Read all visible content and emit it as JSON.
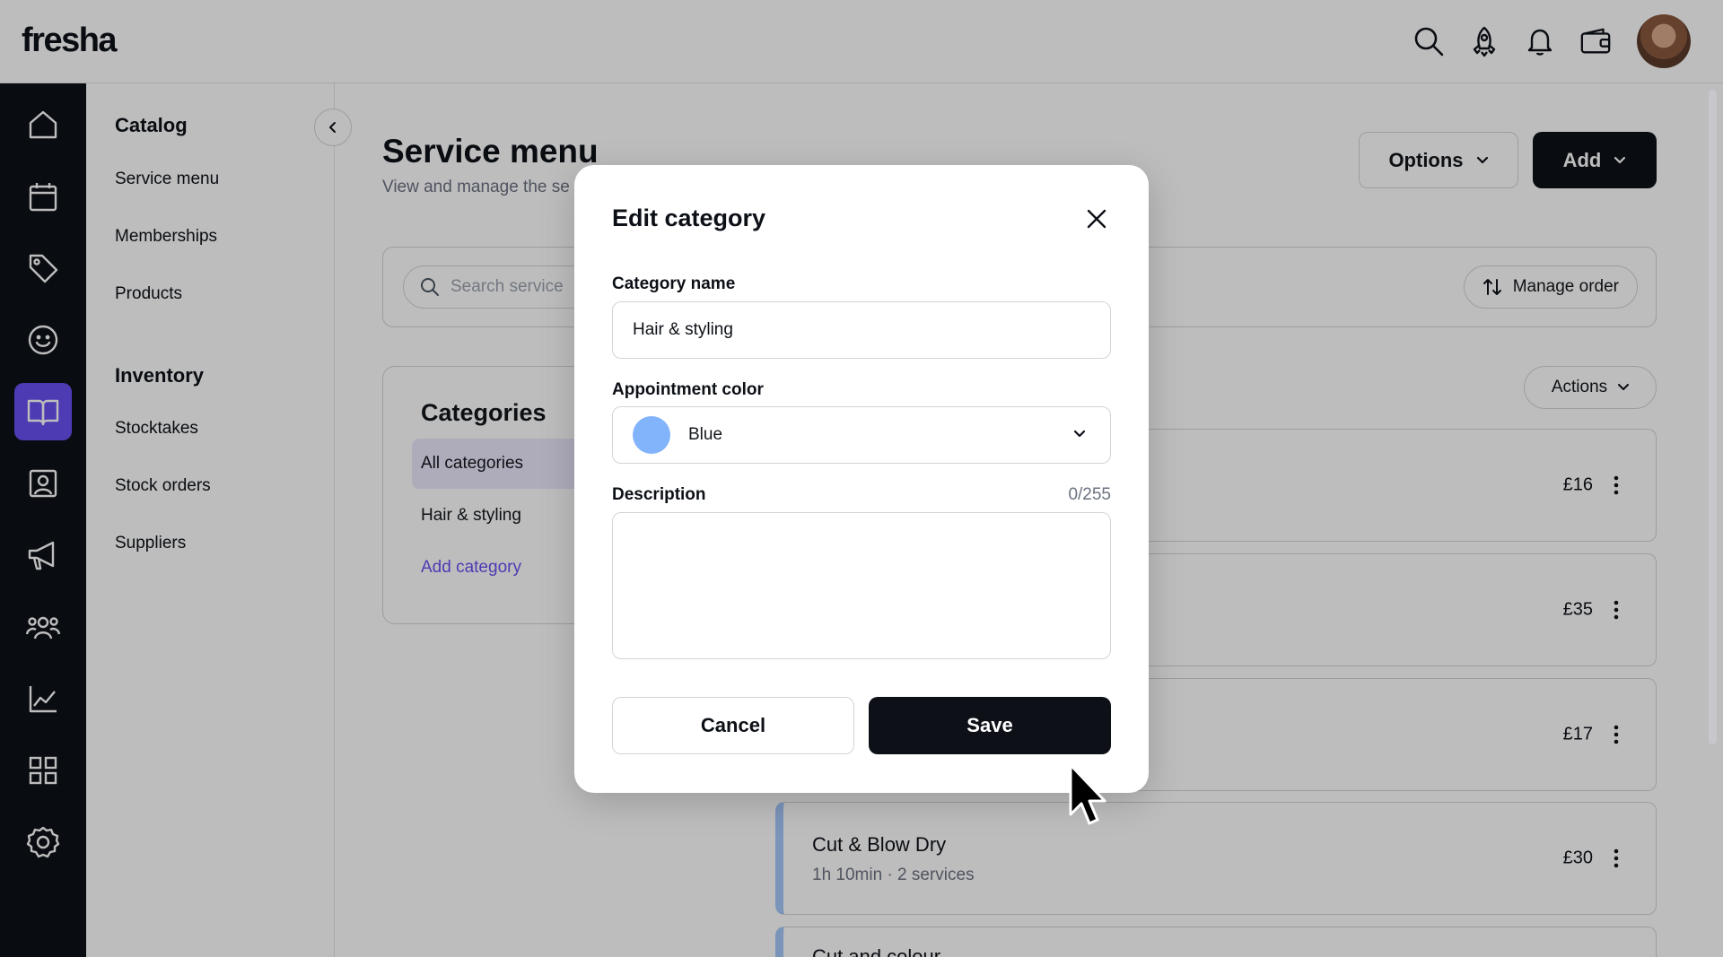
{
  "app": {
    "logo": "fresha"
  },
  "topbar": {
    "icons": [
      "search-icon",
      "rocket-icon",
      "bell-icon",
      "wallet-icon"
    ]
  },
  "rail": {
    "icons": [
      "home-icon",
      "calendar-icon",
      "tag-icon",
      "smiley-icon",
      "book-icon",
      "contact-card-icon",
      "megaphone-icon",
      "team-icon",
      "chart-icon",
      "grid-icon",
      "gear-icon"
    ],
    "active": "book-icon"
  },
  "subnav": {
    "sections": [
      {
        "heading": "Catalog",
        "items": [
          "Service menu",
          "Memberships",
          "Products"
        ]
      },
      {
        "heading": "Inventory",
        "items": [
          "Stocktakes",
          "Stock orders",
          "Suppliers"
        ]
      }
    ]
  },
  "main": {
    "title": "Service menu",
    "subtitle": "View and manage the se",
    "options_label": "Options",
    "add_label": "Add",
    "search_placeholder": "Search service",
    "manage_order_label": "Manage order",
    "actions_label": "Actions",
    "categories": {
      "title": "Categories",
      "items": [
        "All categories",
        "Hair & styling"
      ],
      "add_label": "Add category"
    },
    "services": [
      {
        "name": "",
        "meta": "",
        "price": "£16"
      },
      {
        "name": "",
        "meta": "",
        "price": "£35"
      },
      {
        "name": "",
        "meta": "",
        "price": "£17"
      },
      {
        "name": "Cut & Blow Dry",
        "meta": "1h 10min · 2 services",
        "price": "£30"
      },
      {
        "name": "Cut and colour",
        "meta": "",
        "price": ""
      }
    ]
  },
  "modal": {
    "title": "Edit category",
    "category_name_label": "Category name",
    "category_name_value": "Hair & styling",
    "appointment_color_label": "Appointment color",
    "appointment_color_value": "Blue",
    "appointment_color_hex": "#82b4fb",
    "description_label": "Description",
    "description_count": "0/255",
    "description_value": "",
    "cancel_label": "Cancel",
    "save_label": "Save"
  },
  "colors": {
    "accent": "#6950f3",
    "dark": "#0d1117",
    "service_stripe": "#a5c8fb"
  }
}
